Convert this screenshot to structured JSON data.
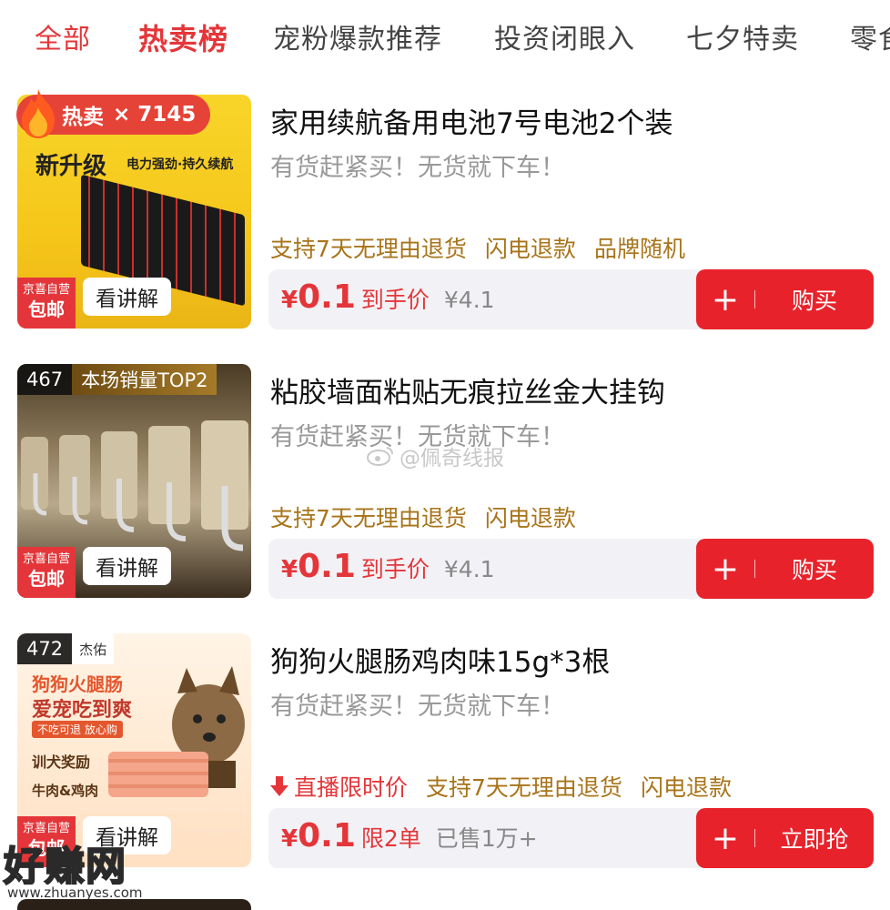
{
  "tabs": [
    "全部",
    "热卖榜",
    "宠粉爆款推荐",
    "投资闭眼入",
    "七夕特卖",
    "零食"
  ],
  "products": [
    {
      "name": "家用续航备用电池7号电池2个装",
      "slogan": "有货赶紧买！无货就下车！",
      "hot_label": "热卖",
      "hot_count": "× 7145",
      "thumb_text1": "新升级",
      "thumb_text2": "电力强劲·持久续航",
      "self_label": "京喜自营",
      "self_ship": "包邮",
      "explain": "看讲解",
      "tags": [
        "支持7天无理由退货",
        "闪电退款",
        "品牌随机"
      ],
      "price_symbol": "¥",
      "price": "0.1",
      "price_label": "到手价",
      "orig_price": "¥4.1",
      "buy_plus": "+",
      "buy_label": "购买"
    },
    {
      "name": "粘胶墙面粘贴无痕拉丝金大挂钩",
      "slogan": "有货赶紧买！无货就下车！",
      "rank": "467",
      "rank_text": "本场销量TOP2",
      "self_label": "京喜自营",
      "self_ship": "包邮",
      "explain": "看讲解",
      "tags": [
        "支持7天无理由退货",
        "闪电退款"
      ],
      "price_symbol": "¥",
      "price": "0.1",
      "price_label": "到手价",
      "orig_price": "¥4.1",
      "buy_plus": "+",
      "buy_label": "购买"
    },
    {
      "name": "狗狗火腿肠鸡肉味15g*3根",
      "slogan": "有货赶紧买！无货就下车！",
      "rank": "472",
      "rank_text": "杰佑",
      "thumb_text1": "狗狗火腿肠",
      "thumb_text2": "爱宠吃到爽",
      "thumb_text3": "不吃可退 放心购",
      "thumb_text4": "训犬奖励",
      "thumb_text5": "牛肉&鸡肉",
      "self_label": "京喜自营",
      "self_ship": "包邮",
      "explain": "看讲解",
      "live_tag": "直播限时价",
      "tags": [
        "支持7天无理由退货",
        "闪电退款"
      ],
      "price_symbol": "¥",
      "price": "0.1",
      "price_label": "限2单",
      "orig_price": "已售1万+",
      "buy_plus": "+",
      "buy_label": "立即抢"
    }
  ],
  "watermark": "@佩奇线报",
  "site_watermark": "好赚网",
  "site_url": "www.zhuanyes.com",
  "colors": {
    "accent": "#e4363a",
    "tag": "#a8741a",
    "button": "#e8222b"
  }
}
